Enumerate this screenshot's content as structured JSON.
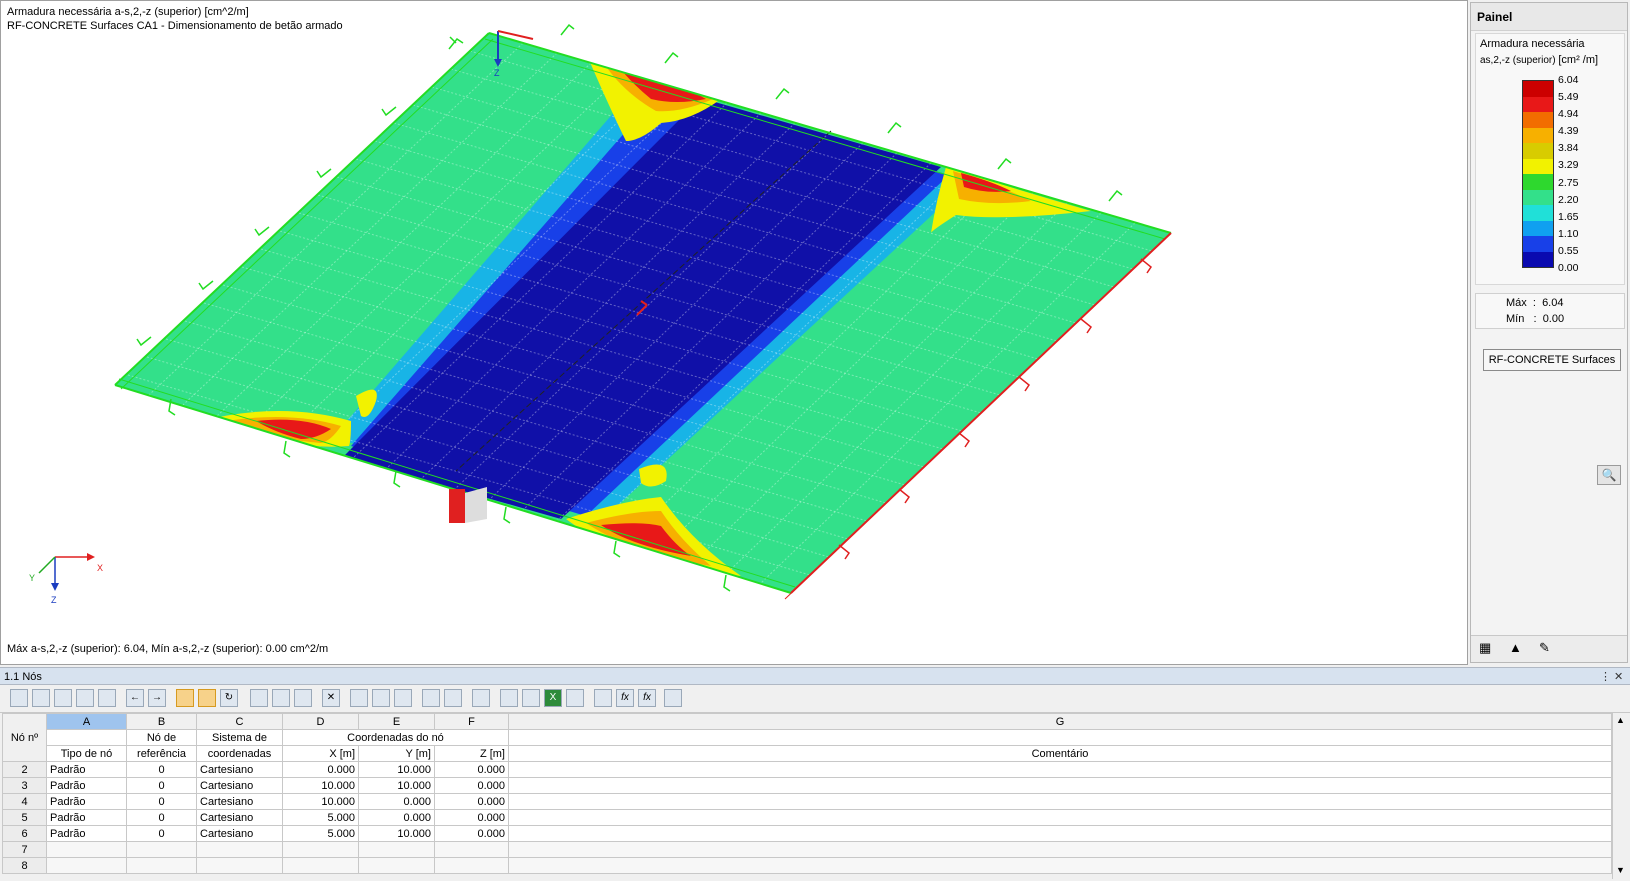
{
  "viewport": {
    "title_line1": "Armadura necessária a-s,2,-z (superior) [cm^2/m]",
    "title_line2": "RF-CONCRETE Surfaces CA1 - Dimensionamento de betão armado",
    "footer": "Máx a-s,2,-z (superior): 6.04, Mín a-s,2,-z (superior): 0.00 cm^2/m",
    "axis_x": "X",
    "axis_y": "Y",
    "axis_z": "Z",
    "colors": {
      "surface": "#33e08a",
      "strip_dark": "#1010a8",
      "strip_mid": "#2a3ad8",
      "strip_light": "#18b4e6",
      "support_red": "#e02020",
      "support_green": "#22dd22"
    }
  },
  "panel": {
    "title": "Painel",
    "legend_title": "Armadura necessária",
    "legend_subtitle_symbol": "as,2,-z (superior)",
    "legend_unit": "[cm² /m]",
    "scale_values": [
      "6.04",
      "5.49",
      "4.94",
      "4.39",
      "3.84",
      "3.29",
      "2.75",
      "2.20",
      "1.65",
      "1.10",
      "0.55",
      "0.00"
    ],
    "scale_colors": [
      "#cc0000",
      "#e81818",
      "#f26d00",
      "#f7b000",
      "#d8cc00",
      "#f2f200",
      "#2ed82e",
      "#33e08a",
      "#20e0d8",
      "#10a0f0",
      "#1840e8",
      "#0a0ab0"
    ],
    "max_label": "Máx",
    "max_value": "6.04",
    "min_label": "Mín",
    "min_value": "0.00",
    "rf_button": "RF-CONCRETE Surfaces"
  },
  "table": {
    "panel_title": "1.1 Nós",
    "col_letters": [
      "A",
      "B",
      "C",
      "D",
      "E",
      "F",
      "G"
    ],
    "hdr_no": "Nó nº",
    "hdr_ref_top": "Nó de",
    "hdr_ref_bottom": "referência",
    "hdr_sys_top": "Sistema de",
    "hdr_sys_bottom": "coordenadas",
    "hdr_coord_group": "Coordenadas do nó",
    "hdr_type": "Tipo de nó",
    "hdr_x": "X [m]",
    "hdr_y": "Y [m]",
    "hdr_z": "Z [m]",
    "hdr_comment": "Comentário",
    "rows": [
      {
        "n": "2",
        "type": "Padrão",
        "ref": "0",
        "sys": "Cartesiano",
        "x": "0.000",
        "y": "10.000",
        "z": "0.000"
      },
      {
        "n": "3",
        "type": "Padrão",
        "ref": "0",
        "sys": "Cartesiano",
        "x": "10.000",
        "y": "10.000",
        "z": "0.000"
      },
      {
        "n": "4",
        "type": "Padrão",
        "ref": "0",
        "sys": "Cartesiano",
        "x": "10.000",
        "y": "0.000",
        "z": "0.000"
      },
      {
        "n": "5",
        "type": "Padrão",
        "ref": "0",
        "sys": "Cartesiano",
        "x": "5.000",
        "y": "0.000",
        "z": "0.000"
      },
      {
        "n": "6",
        "type": "Padrão",
        "ref": "0",
        "sys": "Cartesiano",
        "x": "5.000",
        "y": "10.000",
        "z": "0.000"
      },
      {
        "n": "7",
        "type": "",
        "ref": "",
        "sys": "",
        "x": "",
        "y": "",
        "z": ""
      },
      {
        "n": "8",
        "type": "",
        "ref": "",
        "sys": "",
        "x": "",
        "y": "",
        "z": ""
      }
    ]
  }
}
